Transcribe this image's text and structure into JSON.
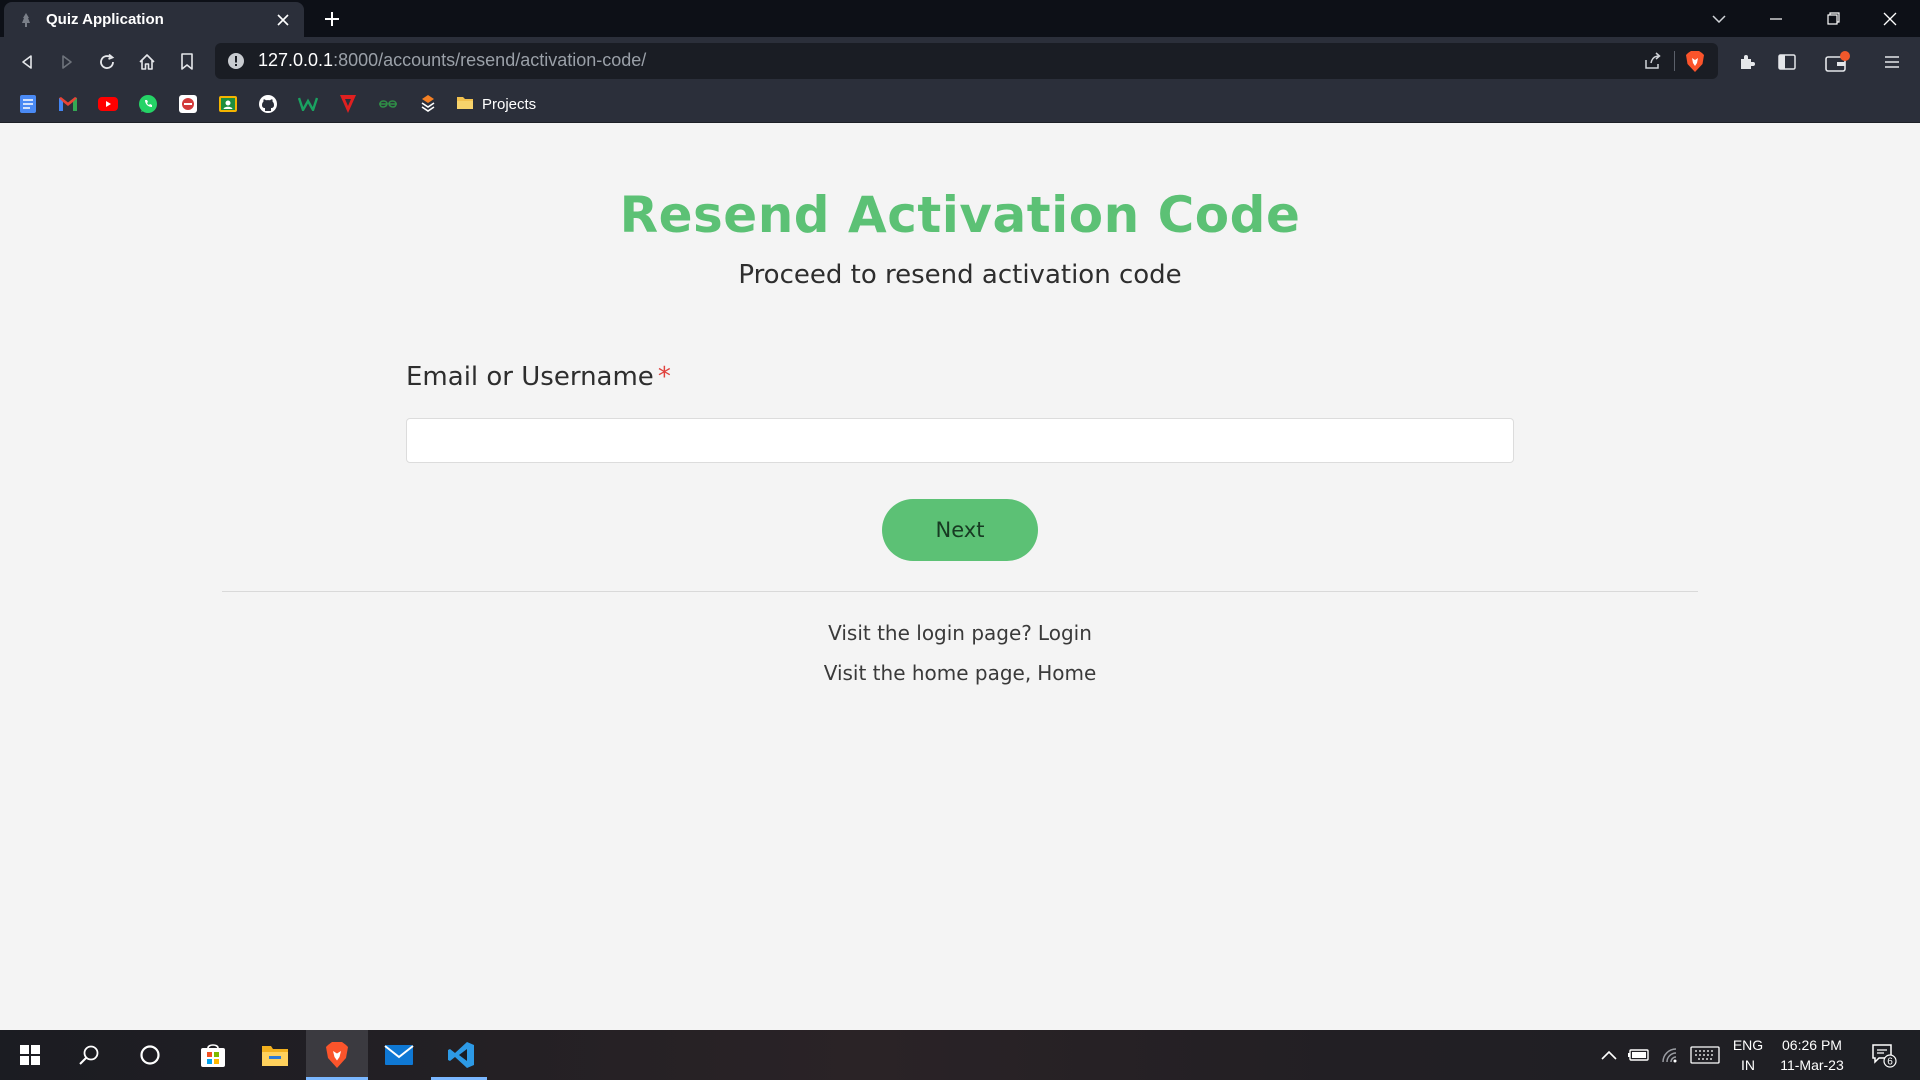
{
  "browser": {
    "tab_title": "Quiz Application",
    "url_host": "127.0.0.1",
    "url_rest": ":8000/accounts/resend/activation-code/",
    "bookmarks": [
      {
        "icon": "google-docs-icon",
        "color": "#4a8af4"
      },
      {
        "icon": "gmail-icon",
        "color": "#ea4335"
      },
      {
        "icon": "youtube-icon",
        "color": "#ff0000"
      },
      {
        "icon": "whatsapp-icon",
        "color": "#25d366"
      },
      {
        "icon": "bookmark-app-icon",
        "color": "#d23b3b"
      },
      {
        "icon": "google-classroom-icon",
        "color": "#f4b400"
      },
      {
        "icon": "github-icon",
        "color": "#ffffff"
      },
      {
        "icon": "w-app-icon",
        "color": "#1aa260"
      },
      {
        "icon": "v-app-icon",
        "color": "#e02020"
      },
      {
        "icon": "geeksforgeeks-icon",
        "color": "#2f8d46"
      },
      {
        "icon": "stack-icon",
        "color": "#f48024"
      }
    ],
    "bookmark_folder": "Projects"
  },
  "page": {
    "title": "Resend Activation Code",
    "subtitle": "Proceed to resend activation code",
    "field_label": "Email or Username",
    "required_mark": "*",
    "field_value": "",
    "next_button": "Next",
    "login_prompt": "Visit the login page?",
    "login_link": "Login",
    "home_prompt": "Visit the home page,",
    "home_link": "Home"
  },
  "colors": {
    "accent": "#5cc175",
    "required": "#e0423d"
  },
  "taskbar": {
    "lang_top": "ENG",
    "lang_bottom": "IN",
    "time": "06:26 PM",
    "date": "11-Mar-23",
    "notification_count": "6"
  }
}
